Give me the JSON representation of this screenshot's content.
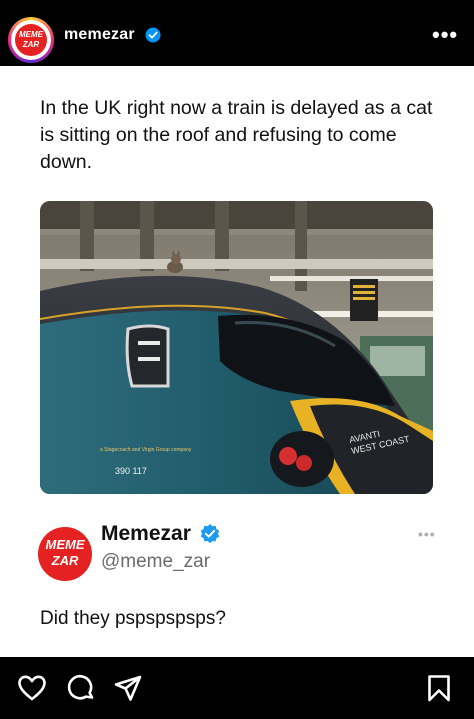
{
  "header": {
    "username": "memezar",
    "avatar_logo_lines": [
      "MEME",
      "ZAR"
    ],
    "more_label": "•••"
  },
  "post": {
    "text": "In the UK right now a train is delayed as a cat is sitting on the roof and refusing to come down.",
    "photo_texts": {
      "brand_line1": "AVANTI",
      "brand_line2": "WEST COAST",
      "unit_number": "390 117",
      "small_print": "a Stagecoach and Virgin Group company"
    }
  },
  "quoted": {
    "name": "Memezar",
    "handle": "@meme_zar",
    "logo_lines": [
      "MEME",
      "ZAR"
    ],
    "more_label": "•••",
    "reply": "Did they pspspspsps?"
  },
  "actions": {
    "icons": [
      "heart-icon",
      "comment-icon",
      "share-icon",
      "bookmark-icon"
    ]
  },
  "colors": {
    "brand_red": "#e52222",
    "verified_blue": "#0095f6",
    "train_teal": "#1f5e6c"
  }
}
